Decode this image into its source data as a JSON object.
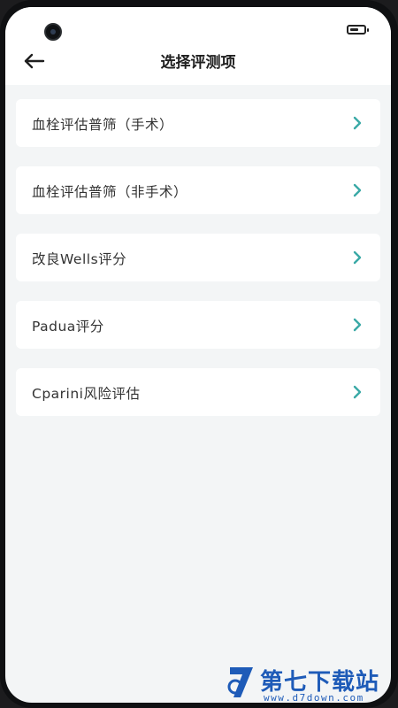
{
  "header": {
    "title": "选择评测项",
    "back_icon": "arrow-left-icon"
  },
  "list": {
    "items": [
      {
        "label": "血栓评估普筛（手术）"
      },
      {
        "label": "血栓评估普筛（非手术）"
      },
      {
        "label": "改良Wells评分"
      },
      {
        "label": "Padua评分"
      },
      {
        "label": "Cparini风险评估"
      }
    ],
    "chevron_icon": "chevron-right-icon"
  },
  "colors": {
    "accent": "#3aa9a6",
    "background": "#f3f5f6",
    "card": "#ffffff",
    "text": "#333333",
    "watermark": "#1e5bb8"
  },
  "watermark": {
    "text": "第七下载站",
    "url": "www.d7down.com"
  }
}
